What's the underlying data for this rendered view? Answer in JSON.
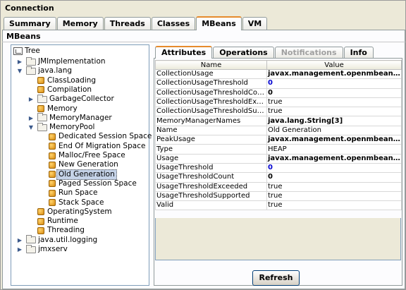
{
  "window": {
    "title": "Connection"
  },
  "main_tabs": [
    {
      "label": "Summary",
      "active": false
    },
    {
      "label": "Memory",
      "active": false
    },
    {
      "label": "Threads",
      "active": false
    },
    {
      "label": "Classes",
      "active": false
    },
    {
      "label": "MBeans",
      "active": true
    },
    {
      "label": "VM",
      "active": false
    }
  ],
  "section": {
    "label": "MBeans"
  },
  "tree": {
    "root": "Tree",
    "nodes": [
      {
        "label": "JMImplementation",
        "type": "folder",
        "expander": "collapsed"
      },
      {
        "label": "java.lang",
        "type": "folder",
        "expander": "expanded"
      },
      {
        "label": "ClassLoading",
        "type": "bean"
      },
      {
        "label": "Compilation",
        "type": "bean"
      },
      {
        "label": "GarbageCollector",
        "type": "folder",
        "expander": "collapsed"
      },
      {
        "label": "Memory",
        "type": "bean"
      },
      {
        "label": "MemoryManager",
        "type": "folder",
        "expander": "collapsed"
      },
      {
        "label": "MemoryPool",
        "type": "folder",
        "expander": "expanded"
      },
      {
        "label": "Dedicated Session Space",
        "type": "bean"
      },
      {
        "label": "End Of Migration Space",
        "type": "bean"
      },
      {
        "label": "Malloc/Free Space",
        "type": "bean"
      },
      {
        "label": "New Generation",
        "type": "bean"
      },
      {
        "label": "Old Generation",
        "type": "bean",
        "selected": true
      },
      {
        "label": "Paged Session Space",
        "type": "bean"
      },
      {
        "label": "Run Space",
        "type": "bean"
      },
      {
        "label": "Stack Space",
        "type": "bean"
      },
      {
        "label": "OperatingSystem",
        "type": "bean"
      },
      {
        "label": "Runtime",
        "type": "bean"
      },
      {
        "label": "Threading",
        "type": "bean"
      },
      {
        "label": "java.util.logging",
        "type": "folder",
        "expander": "collapsed"
      },
      {
        "label": "jmxserv",
        "type": "folder",
        "expander": "collapsed"
      }
    ]
  },
  "sub_tabs": [
    {
      "label": "Attributes",
      "state": "active"
    },
    {
      "label": "Operations",
      "state": "normal"
    },
    {
      "label": "Notifications",
      "state": "disabled"
    },
    {
      "label": "Info",
      "state": "normal"
    }
  ],
  "attributes_table": {
    "headers": [
      "Name",
      "Value"
    ],
    "rows": [
      {
        "name": "CollectionUsage",
        "value": "javax.management.openmbean.Co...",
        "style": "bold"
      },
      {
        "name": "CollectionUsageThreshold",
        "value": "0",
        "style": "blue"
      },
      {
        "name": "CollectionUsageThresholdCount",
        "value": "0",
        "style": "bold"
      },
      {
        "name": "CollectionUsageThresholdExce...",
        "value": "true",
        "style": "plain"
      },
      {
        "name": "CollectionUsageThresholdSupp...",
        "value": "true",
        "style": "plain"
      },
      {
        "name": "MemoryManagerNames",
        "value": "java.lang.String[3]",
        "style": "bold"
      },
      {
        "name": "Name",
        "value": "Old Generation",
        "style": "plain"
      },
      {
        "name": "PeakUsage",
        "value": "javax.management.openmbean.Co...",
        "style": "bold"
      },
      {
        "name": "Type",
        "value": "HEAP",
        "style": "plain"
      },
      {
        "name": "Usage",
        "value": "javax.management.openmbean.Co...",
        "style": "bold"
      },
      {
        "name": "UsageThreshold",
        "value": "0",
        "style": "blue"
      },
      {
        "name": "UsageThresholdCount",
        "value": "0",
        "style": "bold"
      },
      {
        "name": "UsageThresholdExceeded",
        "value": "true",
        "style": "plain"
      },
      {
        "name": "UsageThresholdSupported",
        "value": "true",
        "style": "plain"
      },
      {
        "name": "Valid",
        "value": "true",
        "style": "plain"
      }
    ]
  },
  "buttons": {
    "refresh": "Refresh"
  }
}
